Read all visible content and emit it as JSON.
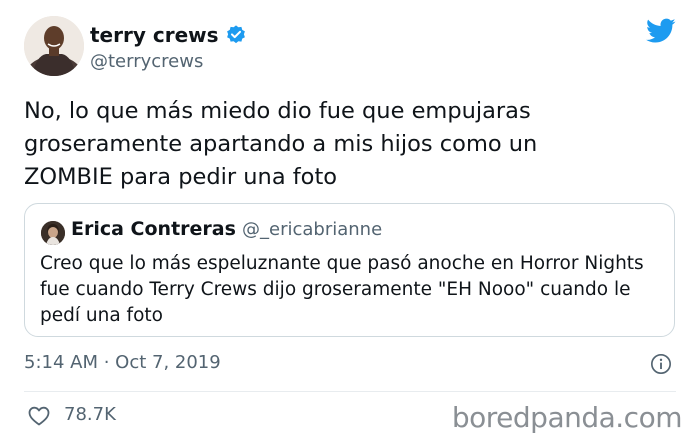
{
  "author": {
    "display_name": "terry crews",
    "handle": "@terrycrews",
    "verified": true,
    "avatar_icon": "avatar-photo"
  },
  "tweet": {
    "text_lines": [
      "No, lo que más miedo dio fue que empujaras",
      "groseramente apartando a mis hijos como un",
      "ZOMBIE para pedir una foto"
    ],
    "timestamp": "5:14 AM · Oct 7, 2019",
    "likes": "78.7K"
  },
  "quoted_tweet": {
    "display_name": "Erica Contreras",
    "handle": "@_ericabrianne",
    "text_lines": [
      "Creo que lo más espeluznante que pasó anoche en Horror Nights",
      "fue cuando Terry Crews dijo groseramente \"EH Nooo\" cuando le",
      "pedí una foto"
    ]
  },
  "watermark": "boredpanda.com",
  "colors": {
    "twitter_blue": "#1d9bf0",
    "secondary_text": "#536471",
    "border": "#cfd9de"
  }
}
